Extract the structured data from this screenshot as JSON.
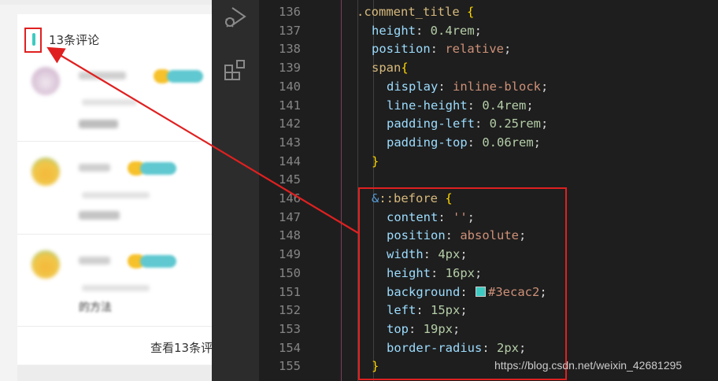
{
  "preview": {
    "comment_title": "13条评论",
    "view_all": "查看13条评",
    "last_comment_text": "的方法",
    "accent_color": "#3ecac2"
  },
  "editor": {
    "lines": [
      {
        "num": "136",
        "indent": 0,
        "tokens": [
          {
            "t": ".comment_title",
            "c": "sel"
          },
          {
            "t": " ",
            "c": "punc"
          },
          {
            "t": "{",
            "c": "brace"
          }
        ]
      },
      {
        "num": "137",
        "indent": 1,
        "tokens": [
          {
            "t": "height",
            "c": "prop"
          },
          {
            "t": ": ",
            "c": "punc"
          },
          {
            "t": "0.4rem",
            "c": "num"
          },
          {
            "t": ";",
            "c": "punc"
          }
        ]
      },
      {
        "num": "138",
        "indent": 1,
        "tokens": [
          {
            "t": "position",
            "c": "prop"
          },
          {
            "t": ": ",
            "c": "punc"
          },
          {
            "t": "relative",
            "c": "val"
          },
          {
            "t": ";",
            "c": "punc"
          }
        ]
      },
      {
        "num": "139",
        "indent": 1,
        "tokens": [
          {
            "t": "span",
            "c": "tag"
          },
          {
            "t": "{",
            "c": "brace"
          }
        ]
      },
      {
        "num": "140",
        "indent": 2,
        "tokens": [
          {
            "t": "display",
            "c": "prop"
          },
          {
            "t": ": ",
            "c": "punc"
          },
          {
            "t": "inline-block",
            "c": "val"
          },
          {
            "t": ";",
            "c": "punc"
          }
        ]
      },
      {
        "num": "141",
        "indent": 2,
        "tokens": [
          {
            "t": "line-height",
            "c": "prop"
          },
          {
            "t": ": ",
            "c": "punc"
          },
          {
            "t": "0.4rem",
            "c": "num"
          },
          {
            "t": ";",
            "c": "punc"
          }
        ]
      },
      {
        "num": "142",
        "indent": 2,
        "tokens": [
          {
            "t": "padding-left",
            "c": "prop"
          },
          {
            "t": ": ",
            "c": "punc"
          },
          {
            "t": "0.25rem",
            "c": "num"
          },
          {
            "t": ";",
            "c": "punc"
          }
        ]
      },
      {
        "num": "143",
        "indent": 2,
        "tokens": [
          {
            "t": "padding-top",
            "c": "prop"
          },
          {
            "t": ": ",
            "c": "punc"
          },
          {
            "t": "0.06rem",
            "c": "num"
          },
          {
            "t": ";",
            "c": "punc"
          }
        ]
      },
      {
        "num": "144",
        "indent": 1,
        "tokens": [
          {
            "t": "}",
            "c": "brace"
          }
        ]
      },
      {
        "num": "145",
        "indent": 0,
        "tokens": []
      },
      {
        "num": "146",
        "indent": 1,
        "tokens": [
          {
            "t": "&",
            "c": "amp"
          },
          {
            "t": "::before",
            "c": "sel"
          },
          {
            "t": " ",
            "c": "punc"
          },
          {
            "t": "{",
            "c": "brace"
          }
        ]
      },
      {
        "num": "147",
        "indent": 2,
        "tokens": [
          {
            "t": "content",
            "c": "prop"
          },
          {
            "t": ": ",
            "c": "punc"
          },
          {
            "t": "''",
            "c": "val"
          },
          {
            "t": ";",
            "c": "punc"
          }
        ]
      },
      {
        "num": "148",
        "indent": 2,
        "tokens": [
          {
            "t": "position",
            "c": "prop"
          },
          {
            "t": ": ",
            "c": "punc"
          },
          {
            "t": "absolute",
            "c": "val"
          },
          {
            "t": ";",
            "c": "punc"
          }
        ]
      },
      {
        "num": "149",
        "indent": 2,
        "tokens": [
          {
            "t": "width",
            "c": "prop"
          },
          {
            "t": ": ",
            "c": "punc"
          },
          {
            "t": "4px",
            "c": "num"
          },
          {
            "t": ";",
            "c": "punc"
          }
        ]
      },
      {
        "num": "150",
        "indent": 2,
        "tokens": [
          {
            "t": "height",
            "c": "prop"
          },
          {
            "t": ": ",
            "c": "punc"
          },
          {
            "t": "16px",
            "c": "num"
          },
          {
            "t": ";",
            "c": "punc"
          }
        ]
      },
      {
        "num": "151",
        "indent": 2,
        "tokens": [
          {
            "t": "background",
            "c": "prop"
          },
          {
            "t": ": ",
            "c": "punc"
          },
          {
            "t": "",
            "c": "swatch"
          },
          {
            "t": "#3ecac2",
            "c": "val"
          },
          {
            "t": ";",
            "c": "punc"
          }
        ]
      },
      {
        "num": "152",
        "indent": 2,
        "tokens": [
          {
            "t": "left",
            "c": "prop"
          },
          {
            "t": ": ",
            "c": "punc"
          },
          {
            "t": "15px",
            "c": "num"
          },
          {
            "t": ";",
            "c": "punc"
          }
        ]
      },
      {
        "num": "153",
        "indent": 2,
        "tokens": [
          {
            "t": "top",
            "c": "prop"
          },
          {
            "t": ": ",
            "c": "punc"
          },
          {
            "t": "19px",
            "c": "num"
          },
          {
            "t": ";",
            "c": "punc"
          }
        ]
      },
      {
        "num": "154",
        "indent": 2,
        "tokens": [
          {
            "t": "border-radius",
            "c": "prop"
          },
          {
            "t": ": ",
            "c": "punc"
          },
          {
            "t": "2px",
            "c": "num"
          },
          {
            "t": ";",
            "c": "punc"
          }
        ]
      },
      {
        "num": "155",
        "indent": 1,
        "tokens": [
          {
            "t": "}",
            "c": "brace"
          }
        ]
      }
    ],
    "swatch_color": "#3ecac2"
  },
  "watermark": "https://blog.csdn.net/weixin_42681295",
  "annotation_color": "#e02020",
  "icons": [
    "run-debug-icon",
    "extensions-icon"
  ]
}
